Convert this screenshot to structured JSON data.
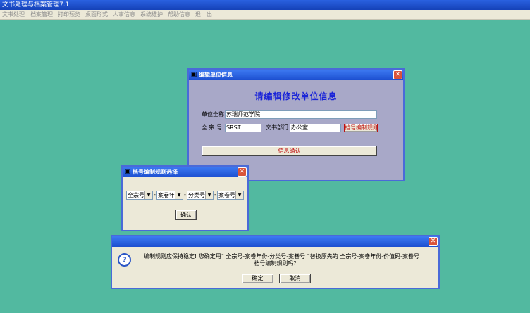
{
  "app": {
    "title": "文书处理与档案管理7.1",
    "menu": [
      "文书处理",
      "档案管理",
      "打印预览",
      "桌面形式",
      "人事信息",
      "系统维护",
      "帮助信息",
      "退",
      "出"
    ]
  },
  "unit_dialog": {
    "title": "编辑单位信息",
    "heading": "请编辑修改单位信息",
    "name_label": "单位全称",
    "name_value": "苏瑞师范学院",
    "fonds_label": "全 宗 号",
    "fonds_value": "SRST",
    "dept_label": "文书部门",
    "dept_value": "办公室",
    "rule_button": "档号编制规则",
    "confirm_button": "信息确认"
  },
  "rule_dialog": {
    "title": "档号编制规则选择",
    "combos": [
      "全宗号",
      "案卷年",
      "分类号",
      "案卷号"
    ],
    "separator": "-",
    "ok_button": "确认"
  },
  "confirm_dialog": {
    "message_line1": "编制规则应保持稳定! 您确定用“ 全宗号-案卷年份-分类号-案卷号 ”替换原先的 全宗号-案卷年份-价值码-案卷号",
    "message_line2": "档号编制规则吗?",
    "question_mark": "?",
    "ok_button": "确定",
    "cancel_button": "取消"
  },
  "icons": {
    "close": "✕",
    "window": "▣"
  }
}
